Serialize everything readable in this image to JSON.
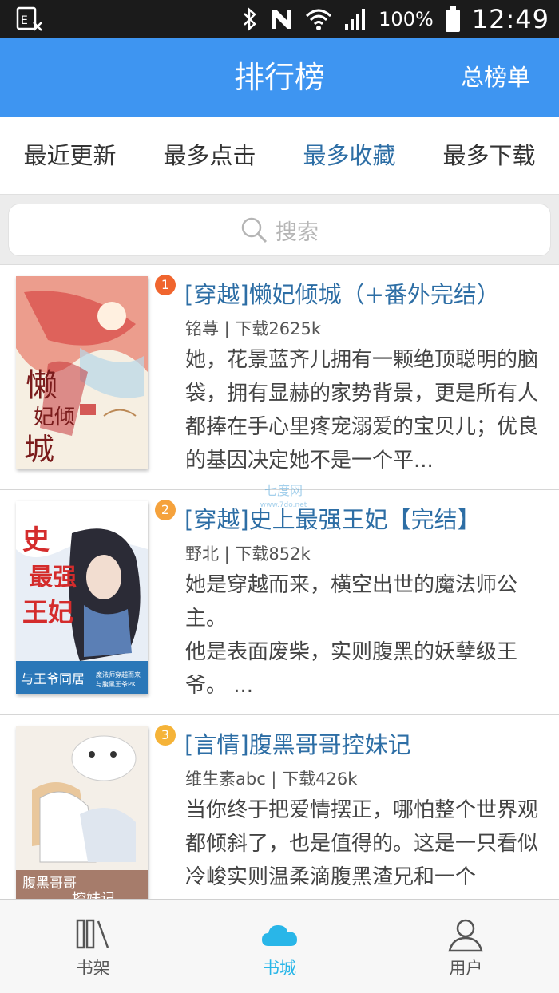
{
  "status_bar": {
    "battery_percent": "100%",
    "time": "12:49",
    "icons": [
      "sim-error-icon",
      "bluetooth-icon",
      "nfc-icon",
      "wifi-icon",
      "signal-icon",
      "battery-icon"
    ]
  },
  "header": {
    "title": "排行榜",
    "action_label": "总榜单",
    "color": "#3e95f1"
  },
  "tabs": [
    {
      "label": "最近更新",
      "active": false
    },
    {
      "label": "最多点击",
      "active": false
    },
    {
      "label": "最多收藏",
      "active": true
    },
    {
      "label": "最多下载",
      "active": false
    }
  ],
  "search": {
    "placeholder": "搜索"
  },
  "books": [
    {
      "rank": "1",
      "rank_color": "#f0652e",
      "title": "[穿越]懒妃倾城（+番外完结）",
      "meta": "铭荨 | 下载2625k",
      "description": [
        "她，花景蓝齐儿拥有一颗绝顶聪明的脑袋，拥有显赫的家势背景，更是所有人都捧在手心里疼宠溺爱的宝贝儿；优良的基因决定她不是一个平..."
      ],
      "cover_text": "懒妃倾城"
    },
    {
      "rank": "2",
      "rank_color": "#f5a23c",
      "title": "[穿越]史上最强王妃【完结】",
      "meta": "野北 | 下载852k",
      "description": [
        "她是穿越而来，横空出世的魔法师公主。",
        "他是表面废柴，实则腹黑的妖孽级王爷。 ..."
      ],
      "cover_text": "史上最强王妃",
      "cover_subtitle": "与王爷同居"
    },
    {
      "rank": "3",
      "rank_color": "#f5b338",
      "title": "[言情]腹黑哥哥控妹记",
      "meta": "维生素abc | 下载426k",
      "description": [
        "当你终于把爱情摆正，哪怕整个世界观都倾斜了，也是值得的。这是一只看似冷峻实则温柔滴腹黑渣兄和一个"
      ],
      "cover_text": "腹黑哥哥控妹记"
    }
  ],
  "watermark": {
    "text": "七度网",
    "url_text": "www.7do.net"
  },
  "bottom_nav": [
    {
      "label": "书架",
      "icon": "bookshelf-icon",
      "active": false
    },
    {
      "label": "书城",
      "icon": "cloud-icon",
      "active": true
    },
    {
      "label": "用户",
      "icon": "user-icon",
      "active": false
    }
  ]
}
